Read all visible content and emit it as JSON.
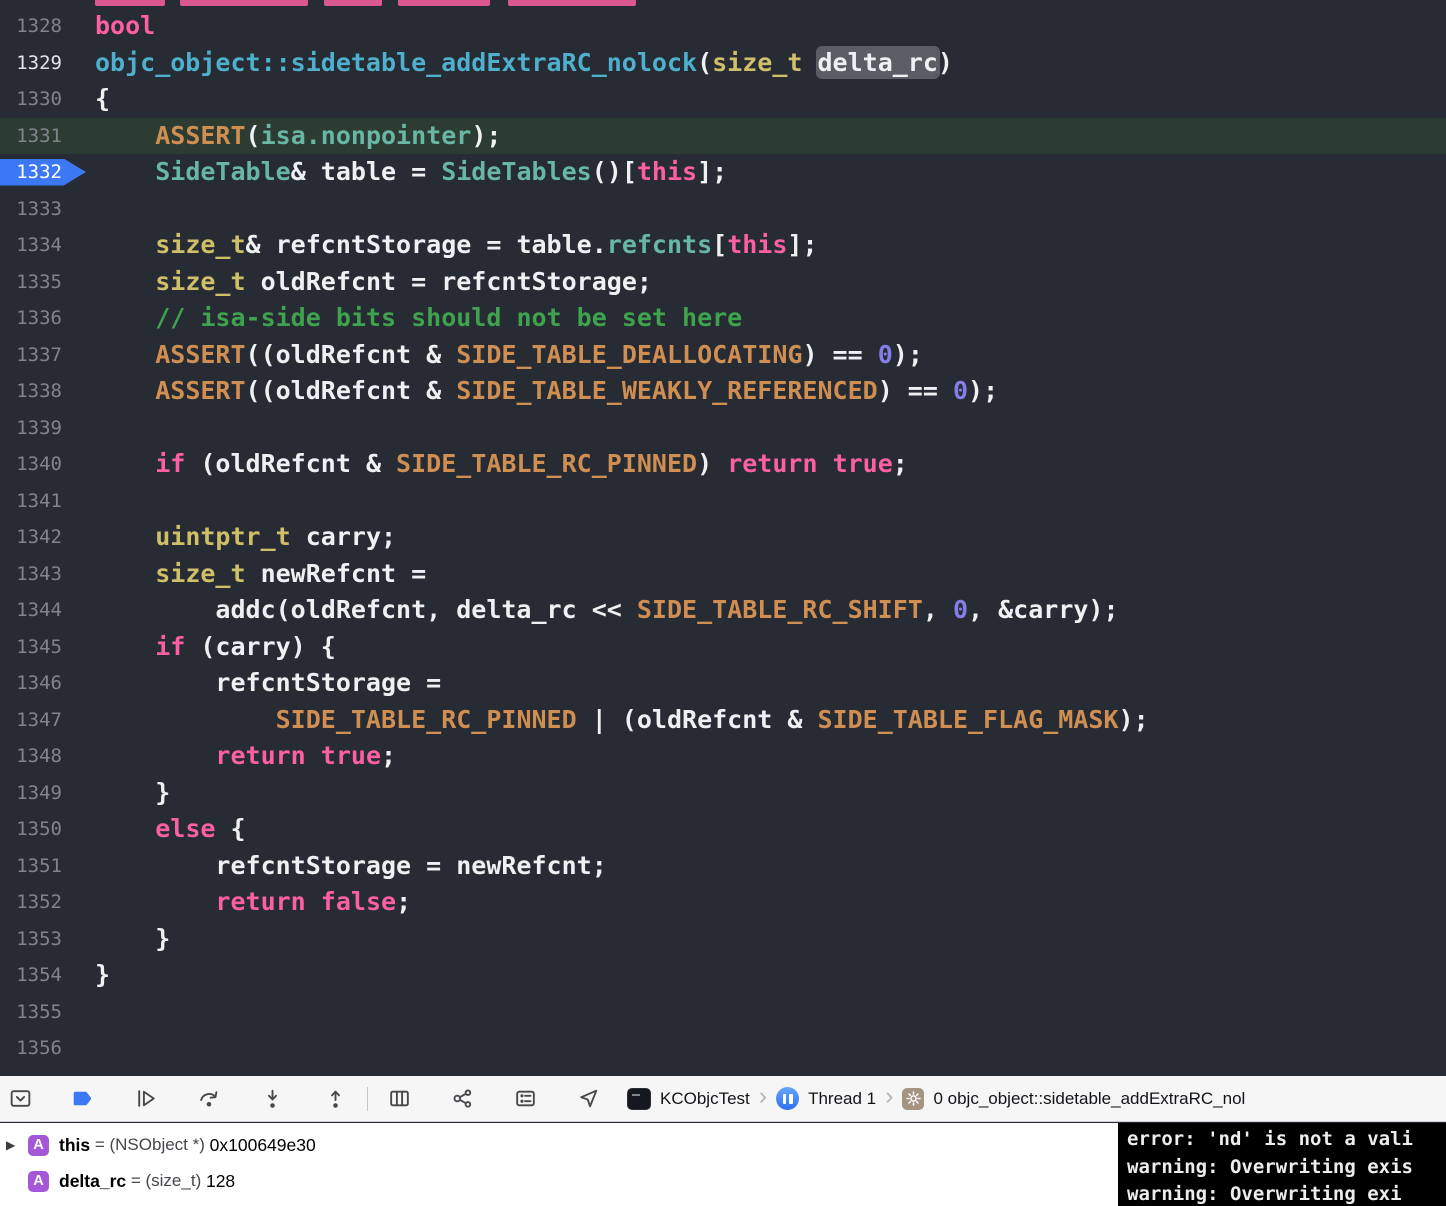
{
  "colors": {
    "kw": "#fc5fa3",
    "ty": "#d0bf69",
    "cl": "#67b7a4",
    "fn": "#4eb0cc",
    "mc": "#d08f52",
    "cm": "#3fa34d",
    "nu": "#867ee8",
    "pl": "#eef0f2",
    "editor_bg": "#272b33",
    "exec_line_bg": "#2d3c33",
    "breakpoint_blue": "#3c78f3",
    "token_highlight_bg": "#5a5e64",
    "line_number": "#80848d"
  },
  "editor": {
    "lines": [
      {
        "n": 1328,
        "s": [
          {
            "t": "bool",
            "c": "kw"
          }
        ]
      },
      {
        "n": 1329,
        "cur": true,
        "s": [
          {
            "t": "objc_object::sidetable_addExtraRC_nolock",
            "c": "fn"
          },
          {
            "t": "(",
            "c": "pl"
          },
          {
            "t": "size_t",
            "c": "ty"
          },
          {
            "t": " ",
            "c": "pl"
          },
          {
            "t": "delta_rc",
            "c": "pl",
            "hl": true
          },
          {
            "t": ")",
            "c": "pl"
          }
        ]
      },
      {
        "n": 1330,
        "s": [
          {
            "t": "{",
            "c": "pl"
          }
        ]
      },
      {
        "n": 1331,
        "exec": true,
        "s": [
          {
            "t": "    ",
            "c": "pl"
          },
          {
            "t": "ASSERT",
            "c": "mc"
          },
          {
            "t": "(",
            "c": "pl"
          },
          {
            "t": "isa.nonpointer",
            "c": "cl"
          },
          {
            "t": ");",
            "c": "pl"
          }
        ]
      },
      {
        "n": 1332,
        "bp": true,
        "s": [
          {
            "t": "    ",
            "c": "pl"
          },
          {
            "t": "SideTable",
            "c": "cl"
          },
          {
            "t": "& table = ",
            "c": "pl"
          },
          {
            "t": "SideTables",
            "c": "cl"
          },
          {
            "t": "()[",
            "c": "pl"
          },
          {
            "t": "this",
            "c": "kw"
          },
          {
            "t": "];",
            "c": "pl"
          }
        ]
      },
      {
        "n": 1333,
        "s": []
      },
      {
        "n": 1334,
        "s": [
          {
            "t": "    ",
            "c": "pl"
          },
          {
            "t": "size_t",
            "c": "ty"
          },
          {
            "t": "& refcntStorage = table.",
            "c": "pl"
          },
          {
            "t": "refcnts",
            "c": "cl"
          },
          {
            "t": "[",
            "c": "pl"
          },
          {
            "t": "this",
            "c": "kw"
          },
          {
            "t": "];",
            "c": "pl"
          }
        ]
      },
      {
        "n": 1335,
        "s": [
          {
            "t": "    ",
            "c": "pl"
          },
          {
            "t": "size_t",
            "c": "ty"
          },
          {
            "t": " oldRefcnt = refcntStorage;",
            "c": "pl"
          }
        ]
      },
      {
        "n": 1336,
        "s": [
          {
            "t": "    ",
            "c": "pl"
          },
          {
            "t": "// isa-side bits should not be set here",
            "c": "cm"
          }
        ]
      },
      {
        "n": 1337,
        "s": [
          {
            "t": "    ",
            "c": "pl"
          },
          {
            "t": "ASSERT",
            "c": "mc"
          },
          {
            "t": "((oldRefcnt & ",
            "c": "pl"
          },
          {
            "t": "SIDE_TABLE_DEALLOCATING",
            "c": "mc"
          },
          {
            "t": ") == ",
            "c": "pl"
          },
          {
            "t": "0",
            "c": "nu"
          },
          {
            "t": ");",
            "c": "pl"
          }
        ]
      },
      {
        "n": 1338,
        "s": [
          {
            "t": "    ",
            "c": "pl"
          },
          {
            "t": "ASSERT",
            "c": "mc"
          },
          {
            "t": "((oldRefcnt & ",
            "c": "pl"
          },
          {
            "t": "SIDE_TABLE_WEAKLY_REFERENCED",
            "c": "mc"
          },
          {
            "t": ") == ",
            "c": "pl"
          },
          {
            "t": "0",
            "c": "nu"
          },
          {
            "t": ");",
            "c": "pl"
          }
        ]
      },
      {
        "n": 1339,
        "s": []
      },
      {
        "n": 1340,
        "s": [
          {
            "t": "    ",
            "c": "pl"
          },
          {
            "t": "if",
            "c": "kw"
          },
          {
            "t": " (oldRefcnt & ",
            "c": "pl"
          },
          {
            "t": "SIDE_TABLE_RC_PINNED",
            "c": "mc"
          },
          {
            "t": ") ",
            "c": "pl"
          },
          {
            "t": "return",
            "c": "kw"
          },
          {
            "t": " ",
            "c": "pl"
          },
          {
            "t": "true",
            "c": "kw"
          },
          {
            "t": ";",
            "c": "pl"
          }
        ]
      },
      {
        "n": 1341,
        "s": []
      },
      {
        "n": 1342,
        "s": [
          {
            "t": "    ",
            "c": "pl"
          },
          {
            "t": "uintptr_t",
            "c": "ty"
          },
          {
            "t": " carry;",
            "c": "pl"
          }
        ]
      },
      {
        "n": 1343,
        "s": [
          {
            "t": "    ",
            "c": "pl"
          },
          {
            "t": "size_t",
            "c": "ty"
          },
          {
            "t": " newRefcnt = ",
            "c": "pl"
          }
        ]
      },
      {
        "n": 1344,
        "s": [
          {
            "t": "        addc(oldRefcnt, delta_rc << ",
            "c": "pl"
          },
          {
            "t": "SIDE_TABLE_RC_SHIFT",
            "c": "mc"
          },
          {
            "t": ", ",
            "c": "pl"
          },
          {
            "t": "0",
            "c": "nu"
          },
          {
            "t": ", &carry);",
            "c": "pl"
          }
        ]
      },
      {
        "n": 1345,
        "s": [
          {
            "t": "    ",
            "c": "pl"
          },
          {
            "t": "if",
            "c": "kw"
          },
          {
            "t": " (carry) {",
            "c": "pl"
          }
        ]
      },
      {
        "n": 1346,
        "s": [
          {
            "t": "        refcntStorage =",
            "c": "pl"
          }
        ]
      },
      {
        "n": 1347,
        "s": [
          {
            "t": "            ",
            "c": "pl"
          },
          {
            "t": "SIDE_TABLE_RC_PINNED",
            "c": "mc"
          },
          {
            "t": " | (oldRefcnt & ",
            "c": "pl"
          },
          {
            "t": "SIDE_TABLE_FLAG_MASK",
            "c": "mc"
          },
          {
            "t": ");",
            "c": "pl"
          }
        ]
      },
      {
        "n": 1348,
        "s": [
          {
            "t": "        ",
            "c": "pl"
          },
          {
            "t": "return",
            "c": "kw"
          },
          {
            "t": " ",
            "c": "pl"
          },
          {
            "t": "true",
            "c": "kw"
          },
          {
            "t": ";",
            "c": "pl"
          }
        ]
      },
      {
        "n": 1349,
        "s": [
          {
            "t": "    }",
            "c": "pl"
          }
        ]
      },
      {
        "n": 1350,
        "s": [
          {
            "t": "    ",
            "c": "pl"
          },
          {
            "t": "else",
            "c": "kw"
          },
          {
            "t": " {",
            "c": "pl"
          }
        ]
      },
      {
        "n": 1351,
        "s": [
          {
            "t": "        refcntStorage = newRefcnt;",
            "c": "pl"
          }
        ]
      },
      {
        "n": 1352,
        "s": [
          {
            "t": "        ",
            "c": "pl"
          },
          {
            "t": "return",
            "c": "kw"
          },
          {
            "t": " ",
            "c": "pl"
          },
          {
            "t": "false",
            "c": "kw"
          },
          {
            "t": ";",
            "c": "pl"
          }
        ]
      },
      {
        "n": 1353,
        "s": [
          {
            "t": "    }",
            "c": "pl"
          }
        ]
      },
      {
        "n": 1354,
        "s": [
          {
            "t": "}",
            "c": "pl"
          }
        ]
      },
      {
        "n": 1355,
        "s": []
      },
      {
        "n": 1356,
        "s": []
      }
    ]
  },
  "debug_bar": {
    "icons": [
      "hide-debug-area",
      "activate-breakpoints",
      "continue",
      "step-over",
      "step-into",
      "step-out",
      "debug-view-hierarchy",
      "debug-memory-graph",
      "environment-overrides",
      "simulate-location"
    ],
    "process": "KCObjcTest",
    "thread": "Thread 1",
    "frame": "0 objc_object::sidetable_addExtraRC_nol"
  },
  "variables": [
    {
      "expandable": true,
      "badge": "A",
      "name": "this",
      "type_part": " = (NSObject *) ",
      "value": "0x100649e30"
    },
    {
      "expandable": false,
      "badge": "A",
      "name": "delta_rc",
      "type_part": " = (size_t) ",
      "value": "128"
    }
  ],
  "console": {
    "lines": [
      "error: 'nd' is not a vali",
      "warning: Overwriting exis",
      "warning: Overwriting exi"
    ]
  }
}
